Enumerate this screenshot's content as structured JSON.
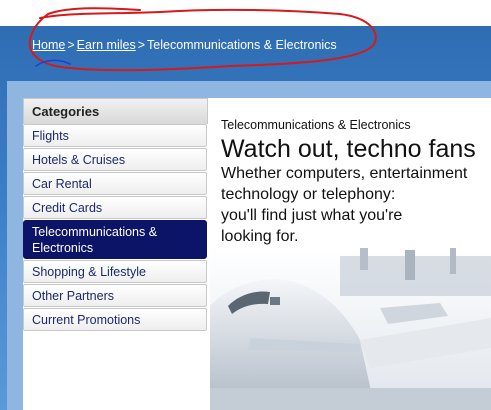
{
  "breadcrumb": {
    "home": "Home",
    "separator": ">",
    "earn_miles": "Earn miles",
    "current": "Telecommunications & Electronics"
  },
  "sidebar": {
    "title": "Categories",
    "items": [
      {
        "label": "Flights"
      },
      {
        "label": "Hotels & Cruises"
      },
      {
        "label": "Car Rental"
      },
      {
        "label": "Credit Cards"
      },
      {
        "label": "Telecommunications & Electronics",
        "active": true
      },
      {
        "label": "Shopping & Lifestyle"
      },
      {
        "label": "Other Partners"
      },
      {
        "label": "Current Promotions"
      }
    ]
  },
  "main": {
    "subtitle": "Telecommunications & Electronics",
    "headline": "Watch out, techno fans",
    "description_lines": [
      "Whether computers, entertainment",
      "technology or telephony:",
      "you'll find just what you're",
      "looking for."
    ]
  },
  "colors": {
    "header_blue": "#3c7fc6",
    "active_item": "#0b1466",
    "annotation_red": "#d41a1a",
    "annotation_blue": "#1f3fd0"
  }
}
